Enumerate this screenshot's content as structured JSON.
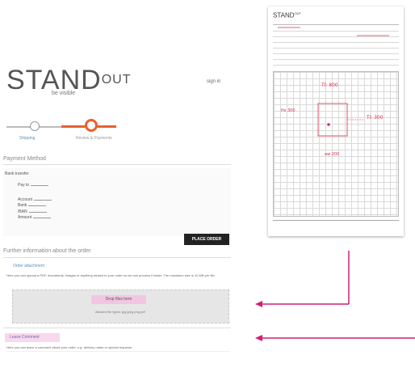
{
  "logo": {
    "word": "STAND",
    "super": "OUT",
    "sub": "be visible"
  },
  "top_link": "sign in",
  "steps": [
    {
      "label": "Shipping"
    },
    {
      "label": "Review & Payments"
    }
  ],
  "payment": {
    "title": "Payment Method",
    "label": "Bank transfer",
    "fields": [
      "Pay to",
      "Account",
      "Bank",
      "IBAN",
      "Amount"
    ]
  },
  "place_order_label": "PLACE ORDER",
  "further_info": {
    "title": "Further information about the order",
    "attachment_link": "Order attachment",
    "attachment_text": "Here you can upload a PDF, documents, images or anything related to your order so we can process it faster. The maximum size is 10 MB per file.",
    "drop_button": "Drop files here",
    "drop_note": "Allowed file types: jpg jpeg png pdf",
    "comment_button": "Leave Comment",
    "comment_text": "Here you can leave a comment about your order, e.g. delivery notes or special requests."
  },
  "document": {
    "logo_word": "STAND",
    "logo_super": "OUT",
    "handwriting": [
      "Tl: 800",
      "Ti: 300",
      "Hs 300",
      "aw 200"
    ]
  },
  "colors": {
    "accent": "#e8612c",
    "arrow": "#d21e78",
    "link": "#5a8fc4",
    "highlight": "#f2c6e2"
  }
}
